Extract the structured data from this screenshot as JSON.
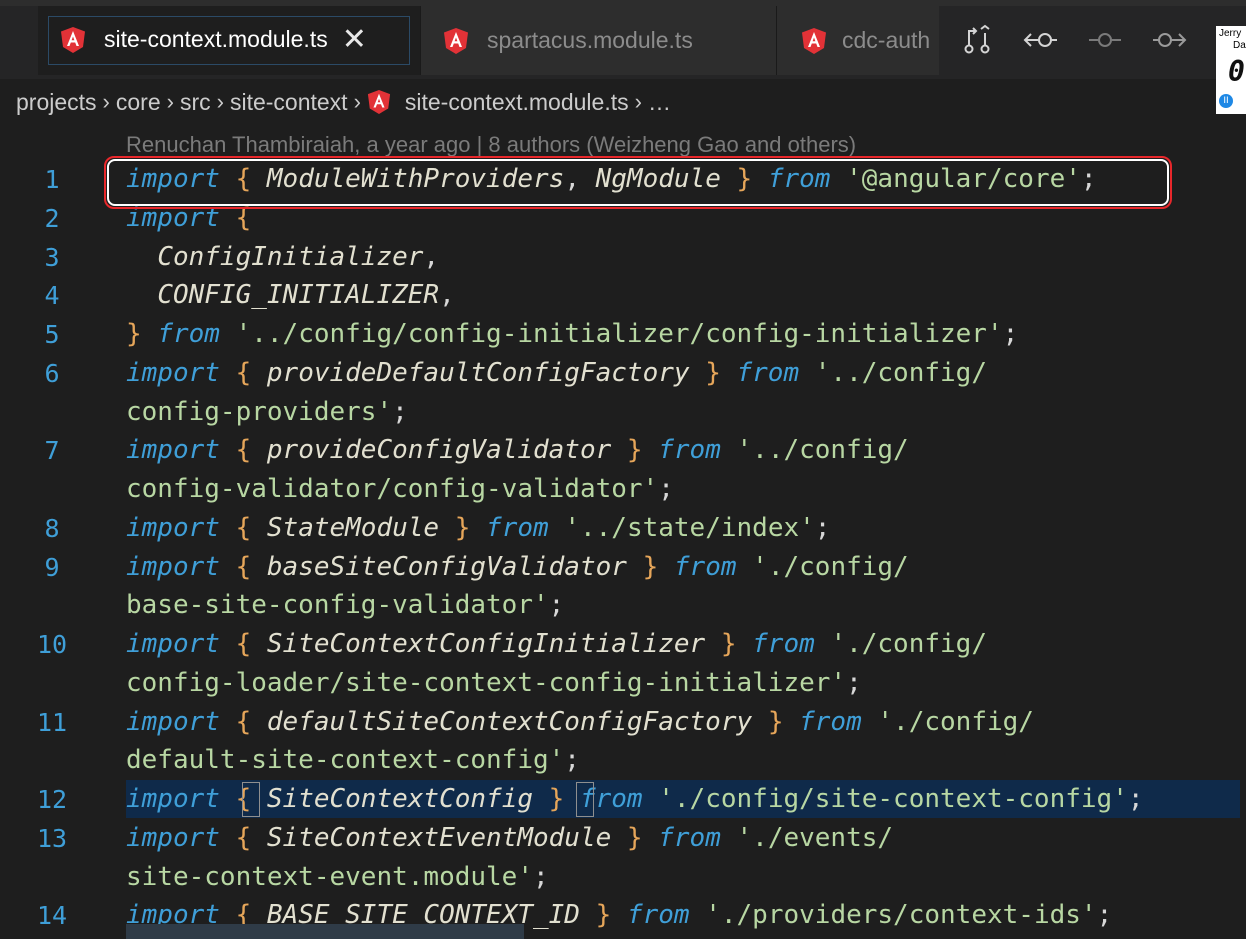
{
  "tabs": [
    {
      "label": "site-context.module.ts",
      "active": true
    },
    {
      "label": "spartacus.module.ts",
      "active": false
    },
    {
      "label": "cdc-auth",
      "active": false
    }
  ],
  "tab_close_glyph": "✕",
  "tab_icon": "angular-icon",
  "actions": [
    {
      "icon": "git-compare-icon"
    },
    {
      "icon": "go-back-commit-icon"
    },
    {
      "icon": "commit-icon"
    },
    {
      "icon": "go-forward-commit-icon"
    }
  ],
  "widget": {
    "line1": "Jerry",
    "line2": "Da",
    "digit": "0",
    "pause": "II"
  },
  "breadcrumb": {
    "items": [
      "projects",
      "core",
      "src",
      "site-context"
    ],
    "file": "site-context.module.ts",
    "ellipsis": "…",
    "separator": "›"
  },
  "blame": "Renuchan Thambiraiah, a year ago | 8 authors (Weizheng Gao and others)",
  "lines": [
    {
      "n": "1",
      "tokens": [
        [
          "kw",
          "import"
        ],
        [
          "pn",
          " "
        ],
        [
          "br",
          "{"
        ],
        [
          "pn",
          " "
        ],
        [
          "id",
          "ModuleWithProviders"
        ],
        [
          "pn",
          ", "
        ],
        [
          "id",
          "NgModule"
        ],
        [
          "pn",
          " "
        ],
        [
          "br",
          "}"
        ],
        [
          "pn",
          " "
        ],
        [
          "kw",
          "from"
        ],
        [
          "pn",
          " "
        ],
        [
          "str",
          "'@angular/core'"
        ],
        [
          "pn",
          ";"
        ]
      ]
    },
    {
      "n": "2",
      "tokens": [
        [
          "kw",
          "import"
        ],
        [
          "pn",
          " "
        ],
        [
          "br",
          "{"
        ]
      ]
    },
    {
      "n": "3",
      "tokens": [
        [
          "pn",
          "  "
        ],
        [
          "id",
          "ConfigInitializer"
        ],
        [
          "pn",
          ","
        ]
      ]
    },
    {
      "n": "4",
      "tokens": [
        [
          "pn",
          "  "
        ],
        [
          "id",
          "CONFIG_INITIALIZER"
        ],
        [
          "pn",
          ","
        ]
      ]
    },
    {
      "n": "5",
      "tokens": [
        [
          "br",
          "}"
        ],
        [
          "pn",
          " "
        ],
        [
          "kw",
          "from"
        ],
        [
          "pn",
          " "
        ],
        [
          "str",
          "'../config/config-initializer/config-initializer'"
        ],
        [
          "pn",
          ";"
        ]
      ]
    },
    {
      "n": "6",
      "tokens": [
        [
          "kw",
          "import"
        ],
        [
          "pn",
          " "
        ],
        [
          "br",
          "{"
        ],
        [
          "pn",
          " "
        ],
        [
          "id",
          "provideDefaultConfigFactory"
        ],
        [
          "pn",
          " "
        ],
        [
          "br",
          "}"
        ],
        [
          "pn",
          " "
        ],
        [
          "kw",
          "from"
        ],
        [
          "pn",
          " "
        ],
        [
          "str",
          "'../config/"
        ]
      ]
    },
    {
      "n": "",
      "tokens": [
        [
          "str",
          "config-providers'"
        ],
        [
          "pn",
          ";"
        ]
      ]
    },
    {
      "n": "7",
      "tokens": [
        [
          "kw",
          "import"
        ],
        [
          "pn",
          " "
        ],
        [
          "br",
          "{"
        ],
        [
          "pn",
          " "
        ],
        [
          "id",
          "provideConfigValidator"
        ],
        [
          "pn",
          " "
        ],
        [
          "br",
          "}"
        ],
        [
          "pn",
          " "
        ],
        [
          "kw",
          "from"
        ],
        [
          "pn",
          " "
        ],
        [
          "str",
          "'../config/"
        ]
      ]
    },
    {
      "n": "",
      "tokens": [
        [
          "str",
          "config-validator/config-validator'"
        ],
        [
          "pn",
          ";"
        ]
      ]
    },
    {
      "n": "8",
      "tokens": [
        [
          "kw",
          "import"
        ],
        [
          "pn",
          " "
        ],
        [
          "br",
          "{"
        ],
        [
          "pn",
          " "
        ],
        [
          "id",
          "StateModule"
        ],
        [
          "pn",
          " "
        ],
        [
          "br",
          "}"
        ],
        [
          "pn",
          " "
        ],
        [
          "kw",
          "from"
        ],
        [
          "pn",
          " "
        ],
        [
          "str",
          "'../state/index'"
        ],
        [
          "pn",
          ";"
        ]
      ]
    },
    {
      "n": "9",
      "tokens": [
        [
          "kw",
          "import"
        ],
        [
          "pn",
          " "
        ],
        [
          "br",
          "{"
        ],
        [
          "pn",
          " "
        ],
        [
          "id",
          "baseSiteConfigValidator"
        ],
        [
          "pn",
          " "
        ],
        [
          "br",
          "}"
        ],
        [
          "pn",
          " "
        ],
        [
          "kw",
          "from"
        ],
        [
          "pn",
          " "
        ],
        [
          "str",
          "'./config/"
        ]
      ]
    },
    {
      "n": "",
      "tokens": [
        [
          "str",
          "base-site-config-validator'"
        ],
        [
          "pn",
          ";"
        ]
      ]
    },
    {
      "n": "10",
      "tokens": [
        [
          "kw",
          "import"
        ],
        [
          "pn",
          " "
        ],
        [
          "br",
          "{"
        ],
        [
          "pn",
          " "
        ],
        [
          "id",
          "SiteContextConfigInitializer"
        ],
        [
          "pn",
          " "
        ],
        [
          "br",
          "}"
        ],
        [
          "pn",
          " "
        ],
        [
          "kw",
          "from"
        ],
        [
          "pn",
          " "
        ],
        [
          "str",
          "'./config/"
        ]
      ]
    },
    {
      "n": "",
      "tokens": [
        [
          "str",
          "config-loader/site-context-config-initializer'"
        ],
        [
          "pn",
          ";"
        ]
      ]
    },
    {
      "n": "11",
      "tokens": [
        [
          "kw",
          "import"
        ],
        [
          "pn",
          " "
        ],
        [
          "br",
          "{"
        ],
        [
          "pn",
          " "
        ],
        [
          "id",
          "defaultSiteContextConfigFactory"
        ],
        [
          "pn",
          " "
        ],
        [
          "br",
          "}"
        ],
        [
          "pn",
          " "
        ],
        [
          "kw",
          "from"
        ],
        [
          "pn",
          " "
        ],
        [
          "str",
          "'./config/"
        ]
      ]
    },
    {
      "n": "",
      "tokens": [
        [
          "str",
          "default-site-context-config'"
        ],
        [
          "pn",
          ";"
        ]
      ]
    },
    {
      "n": "12",
      "tokens": [
        [
          "kw",
          "import"
        ],
        [
          "pn",
          " "
        ],
        [
          "br",
          "{"
        ],
        [
          "pn",
          " "
        ],
        [
          "id",
          "SiteContextConfig"
        ],
        [
          "pn",
          " "
        ],
        [
          "br",
          "}"
        ],
        [
          "pn",
          " "
        ],
        [
          "kw",
          "from"
        ],
        [
          "pn",
          " "
        ],
        [
          "str",
          "'./config/site-context-config'"
        ],
        [
          "pn",
          ";"
        ]
      ]
    },
    {
      "n": "13",
      "tokens": [
        [
          "kw",
          "import"
        ],
        [
          "pn",
          " "
        ],
        [
          "br",
          "{"
        ],
        [
          "pn",
          " "
        ],
        [
          "id",
          "SiteContextEventModule"
        ],
        [
          "pn",
          " "
        ],
        [
          "br",
          "}"
        ],
        [
          "pn",
          " "
        ],
        [
          "kw",
          "from"
        ],
        [
          "pn",
          " "
        ],
        [
          "str",
          "'./events/"
        ]
      ]
    },
    {
      "n": "",
      "tokens": [
        [
          "str",
          "site-context-event.module'"
        ],
        [
          "pn",
          ";"
        ]
      ]
    },
    {
      "n": "14",
      "tokens": [
        [
          "kw",
          "import"
        ],
        [
          "pn",
          " "
        ],
        [
          "br",
          "{"
        ],
        [
          "pn",
          " "
        ],
        [
          "id",
          "BASE_SITE_CONTEXT_ID"
        ],
        [
          "pn",
          " "
        ],
        [
          "br",
          "}"
        ],
        [
          "pn",
          " "
        ],
        [
          "kw",
          "from"
        ],
        [
          "pn",
          " "
        ],
        [
          "str",
          "'./providers/context-ids'"
        ],
        [
          "pn",
          ";"
        ]
      ]
    }
  ],
  "colors": {
    "keyword": "#3f9fd8",
    "string": "#b8d7a3",
    "identifier": "#e2e0d0",
    "brace": "#e6a65a",
    "line_number": "#3f9fd8",
    "highlight_box": "#e8272b",
    "current_line": "#0f2a4a"
  }
}
